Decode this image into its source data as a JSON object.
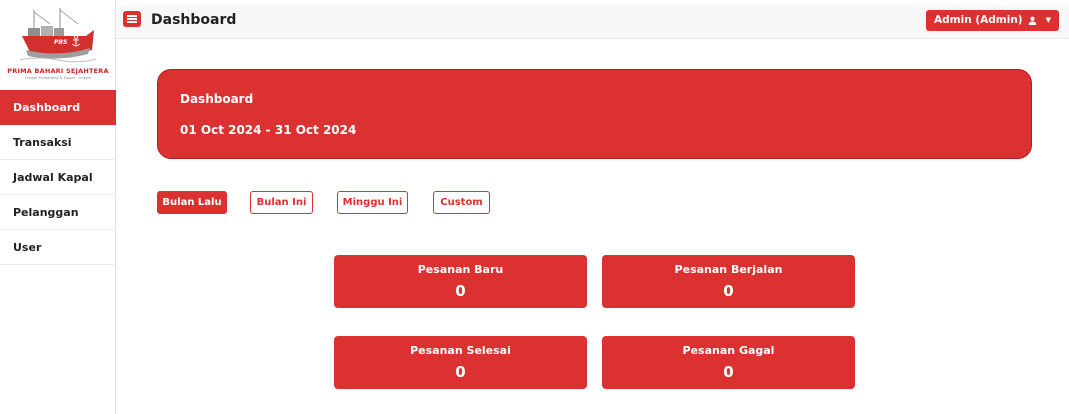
{
  "brand": {
    "name": "PRIMA BAHARI SEJAHTERA",
    "tagline": "Freight Forwarding & Export - Import",
    "ship_mark": "PBS"
  },
  "sidebar": {
    "items": [
      {
        "label": "Dashboard",
        "active": true
      },
      {
        "label": "Transaksi",
        "active": false
      },
      {
        "label": "Jadwal Kapal",
        "active": false
      },
      {
        "label": "Pelanggan",
        "active": false
      },
      {
        "label": "User",
        "active": false
      }
    ]
  },
  "header": {
    "title": "Dashboard",
    "user_label": "Admin (Admin)",
    "menu_icon": "hamburger-icon",
    "user_icon": "user-icon"
  },
  "banner": {
    "title": "Dashboard",
    "date_range": "01 Oct 2024 - 31 Oct 2024"
  },
  "filters": [
    {
      "label": "Bulan Lalu",
      "selected": true
    },
    {
      "label": "Bulan Ini",
      "selected": false
    },
    {
      "label": "Minggu Ini",
      "selected": false
    },
    {
      "label": "Custom",
      "selected": false
    }
  ],
  "stats": [
    {
      "label": "Pesanan Baru",
      "value": "0"
    },
    {
      "label": "Pesanan Berjalan",
      "value": "0"
    },
    {
      "label": "Pesanan Selesai",
      "value": "0"
    },
    {
      "label": "Pesanan Gagal",
      "value": "0"
    }
  ],
  "colors": {
    "accent": "#dc3131",
    "accent_border": "#b71c1c"
  }
}
